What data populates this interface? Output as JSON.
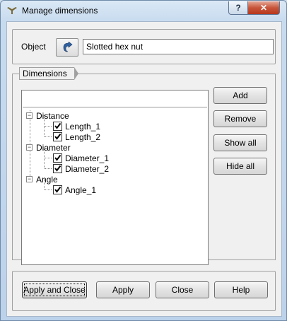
{
  "window": {
    "title": "Manage dimensions",
    "help_glyph": "?",
    "close_glyph": "✕"
  },
  "object": {
    "label": "Object",
    "value": "Slotted hex nut"
  },
  "dimensions_tab": "Dimensions",
  "tree": [
    {
      "label": "Distance",
      "children": [
        "Length_1",
        "Length_2"
      ]
    },
    {
      "label": "Diameter",
      "children": [
        "Diameter_1",
        "Diameter_2"
      ]
    },
    {
      "label": "Angle",
      "children": [
        "Angle_1"
      ]
    }
  ],
  "tree_labels": {
    "g0": "Distance",
    "g0c0": "Length_1",
    "g0c1": "Length_2",
    "g1": "Diameter",
    "g1c0": "Diameter_1",
    "g1c1": "Diameter_2",
    "g2": "Angle",
    "g2c0": "Angle_1"
  },
  "side_buttons": {
    "add": "Add",
    "remove": "Remove",
    "show_all": "Show all",
    "hide_all": "Hide all"
  },
  "footer_buttons": {
    "apply_close": "Apply and Close",
    "apply": "Apply",
    "close": "Close",
    "help": "Help"
  }
}
